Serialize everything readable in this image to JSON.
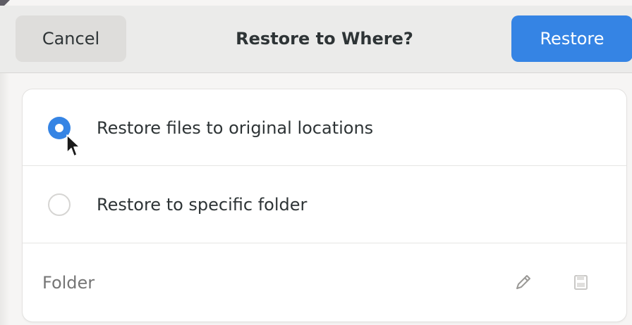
{
  "header": {
    "cancel_label": "Cancel",
    "title": "Restore to Where?",
    "restore_label": "Restore"
  },
  "options": [
    {
      "label": "Restore files to original locations",
      "selected": true
    },
    {
      "label": "Restore to specific folder",
      "selected": false
    }
  ],
  "folder": {
    "placeholder": "Folder",
    "value": ""
  },
  "icons": {
    "edit": "pencil-icon",
    "save": "document-save-icon"
  },
  "colors": {
    "accent": "#3584e4",
    "header_bg": "#ebebea",
    "page_bg": "#f6f5f4",
    "card_bg": "#ffffff"
  }
}
